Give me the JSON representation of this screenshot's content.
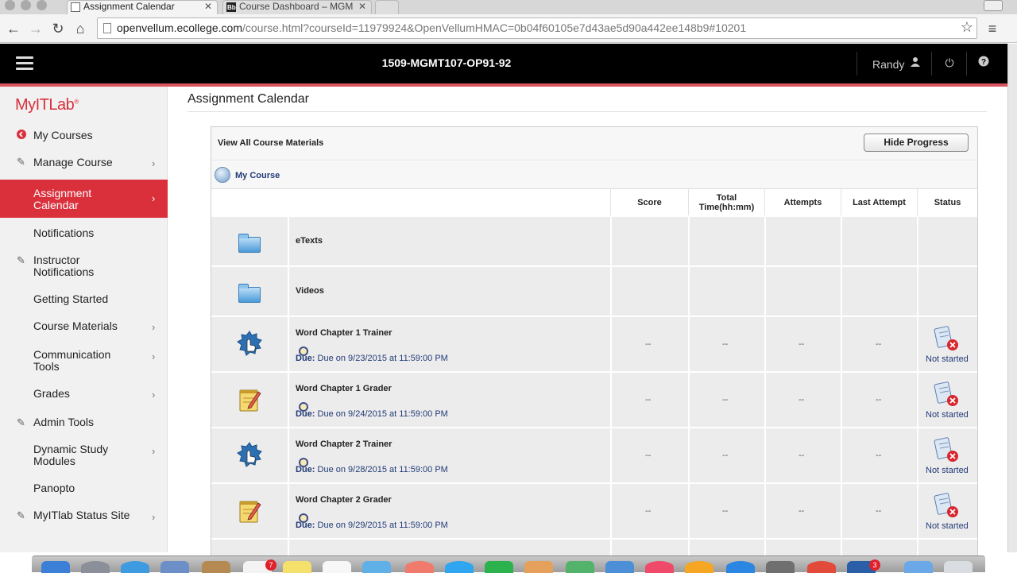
{
  "browser": {
    "tabs": [
      {
        "title": "Assignment Calendar",
        "active": true
      },
      {
        "title": "Course Dashboard – MGM",
        "active": false
      }
    ],
    "url_host": "openvellum.ecollege.com",
    "url_rest": "/course.html?courseId=11979924&OpenVellumHMAC=0b04f60105e7d43ae5d90a442ee148b9#10201",
    "icons": {
      "back": "back-arrow-icon",
      "forward": "forward-arrow-icon",
      "reload": "reload-icon",
      "home": "home-icon",
      "star": "bookmark-star-icon",
      "menu": "chrome-menu-icon"
    }
  },
  "header": {
    "course_code": "1509-MGMT107-OP91-92",
    "user": "Randy",
    "bg": "#000000",
    "accent": "#d9545e"
  },
  "sidebar": {
    "logo": "MyITLab",
    "logo_mark": "®",
    "items": [
      {
        "label": "My Courses",
        "icon": "back-circle-icon",
        "chevron": false,
        "active": false
      },
      {
        "label": "Manage Course",
        "icon": "wrench-icon",
        "chevron": true,
        "active": false
      },
      {
        "label": "Assignment Calendar",
        "icon": "",
        "chevron": true,
        "active": true
      },
      {
        "label": "Notifications",
        "icon": "",
        "chevron": false,
        "active": false
      },
      {
        "label": "Instructor Notifications",
        "icon": "wrench-icon",
        "chevron": false,
        "active": false
      },
      {
        "label": "Getting Started",
        "icon": "",
        "chevron": false,
        "active": false
      },
      {
        "label": "Course Materials",
        "icon": "",
        "chevron": true,
        "active": false
      },
      {
        "label": "Communication Tools",
        "icon": "",
        "chevron": true,
        "active": false
      },
      {
        "label": "Grades",
        "icon": "",
        "chevron": true,
        "active": false
      },
      {
        "label": "Admin Tools",
        "icon": "wrench-icon",
        "chevron": false,
        "active": false
      },
      {
        "label": "Dynamic Study Modules",
        "icon": "",
        "chevron": true,
        "active": false
      },
      {
        "label": "Panopto",
        "icon": "",
        "chevron": false,
        "active": false
      },
      {
        "label": "MyITlab Status Site",
        "icon": "wrench-icon",
        "chevron": true,
        "active": false
      }
    ],
    "active_color": "#d9303c"
  },
  "main": {
    "title": "Assignment Calendar",
    "view_all": "View All Course Materials",
    "hide_progress": "Hide Progress",
    "breadcrumb": "My Course",
    "columns": [
      "Score",
      "Total Time(hh:mm)",
      "Attempts",
      "Last Attempt",
      "Status"
    ],
    "rows": [
      {
        "title": "eTexts",
        "icon": "folder-icon",
        "due_label": "",
        "due": "",
        "score": "",
        "time": "",
        "attempts": "",
        "last": "",
        "status": ""
      },
      {
        "title": "Videos",
        "icon": "folder-icon",
        "due_label": "",
        "due": "",
        "score": "",
        "time": "",
        "attempts": "",
        "last": "",
        "status": ""
      },
      {
        "title": "Word Chapter 1 Trainer",
        "icon": "trainer-gear-icon",
        "due_label": "Due:",
        "due": "Due on 9/23/2015 at 11:59:00 PM",
        "score": "--",
        "time": "--",
        "attempts": "--",
        "last": "--",
        "status": "Not started"
      },
      {
        "title": "Word Chapter 1 Grader",
        "icon": "grader-notepad-icon",
        "due_label": "Due:",
        "due": "Due on 9/24/2015 at 11:59:00 PM",
        "score": "--",
        "time": "--",
        "attempts": "--",
        "last": "--",
        "status": "Not started"
      },
      {
        "title": "Word Chapter 2 Trainer",
        "icon": "trainer-gear-icon",
        "due_label": "Due:",
        "due": "Due on 9/28/2015 at 11:59:00 PM",
        "score": "--",
        "time": "--",
        "attempts": "--",
        "last": "--",
        "status": "Not started"
      },
      {
        "title": "Word Chapter 2 Grader",
        "icon": "grader-notepad-icon",
        "due_label": "Due:",
        "due": "Due on 9/29/2015 at 11:59:00 PM",
        "score": "--",
        "time": "--",
        "attempts": "--",
        "last": "--",
        "status": "Not started"
      }
    ]
  },
  "dock": {
    "badges": [
      "7",
      "3"
    ]
  }
}
